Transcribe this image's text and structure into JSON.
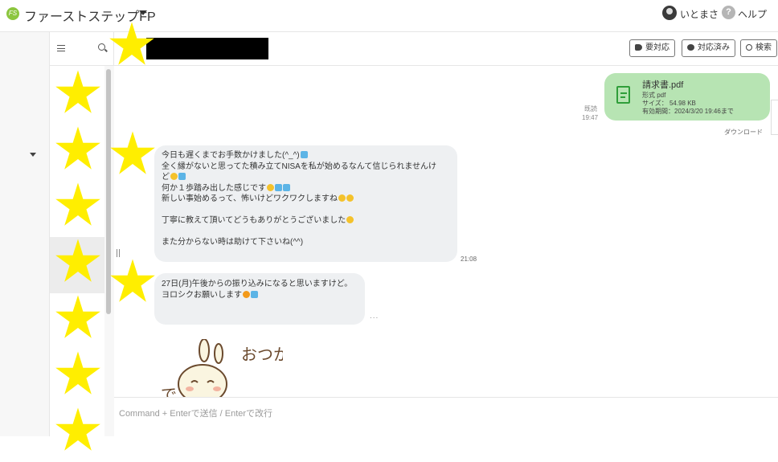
{
  "topbar": {
    "app_title": "ファーストステップFP",
    "user_name": "いとまさ",
    "help_label": "ヘルプ"
  },
  "chat_header": {
    "buttons": [
      {
        "label": "要対応",
        "icon": "tag-icon"
      },
      {
        "label": "対応済み",
        "icon": "chat-bubble-icon"
      },
      {
        "label": "検索",
        "icon": "search-icon"
      }
    ]
  },
  "file_message": {
    "file_name": "請求書.pdf",
    "format": "形式 pdf",
    "size": "サイズ： 54.98 KB",
    "expiry": "有効期間：2024/3/20 19:46まで",
    "read_label": "既読",
    "time": "19:47",
    "download_label": "ダウンロード"
  },
  "messages": [
    {
      "lines": [
        "今日も遅くまでお手数かけました(^_^)",
        "全く縁がないと思ってた積み立てNISAを私が始めるなんて信じられませんけ",
        "ど",
        "何か１歩踏み出した感じです",
        "新しい事始めるって、怖いけどワクワクしますね",
        "",
        "丁寧に教えて頂いてどうもありがとうございました",
        "",
        "また分からない時は助けて下さいね(^^)"
      ],
      "time": "21:08"
    },
    {
      "lines": [
        "27日(月)午後からの振り込みになると思いますけど。",
        "ヨロシクお願いします"
      ],
      "more": "..."
    }
  ],
  "sticker": {
    "text_right": "おつか",
    "text_left": "で"
  },
  "composer": {
    "placeholder": "Command + Enterで送信 / Enterで改行"
  },
  "colors": {
    "file_bubble": "#b7e4b3",
    "incoming_bubble": "#eef0f2",
    "star_overlay": "#ffee00"
  }
}
